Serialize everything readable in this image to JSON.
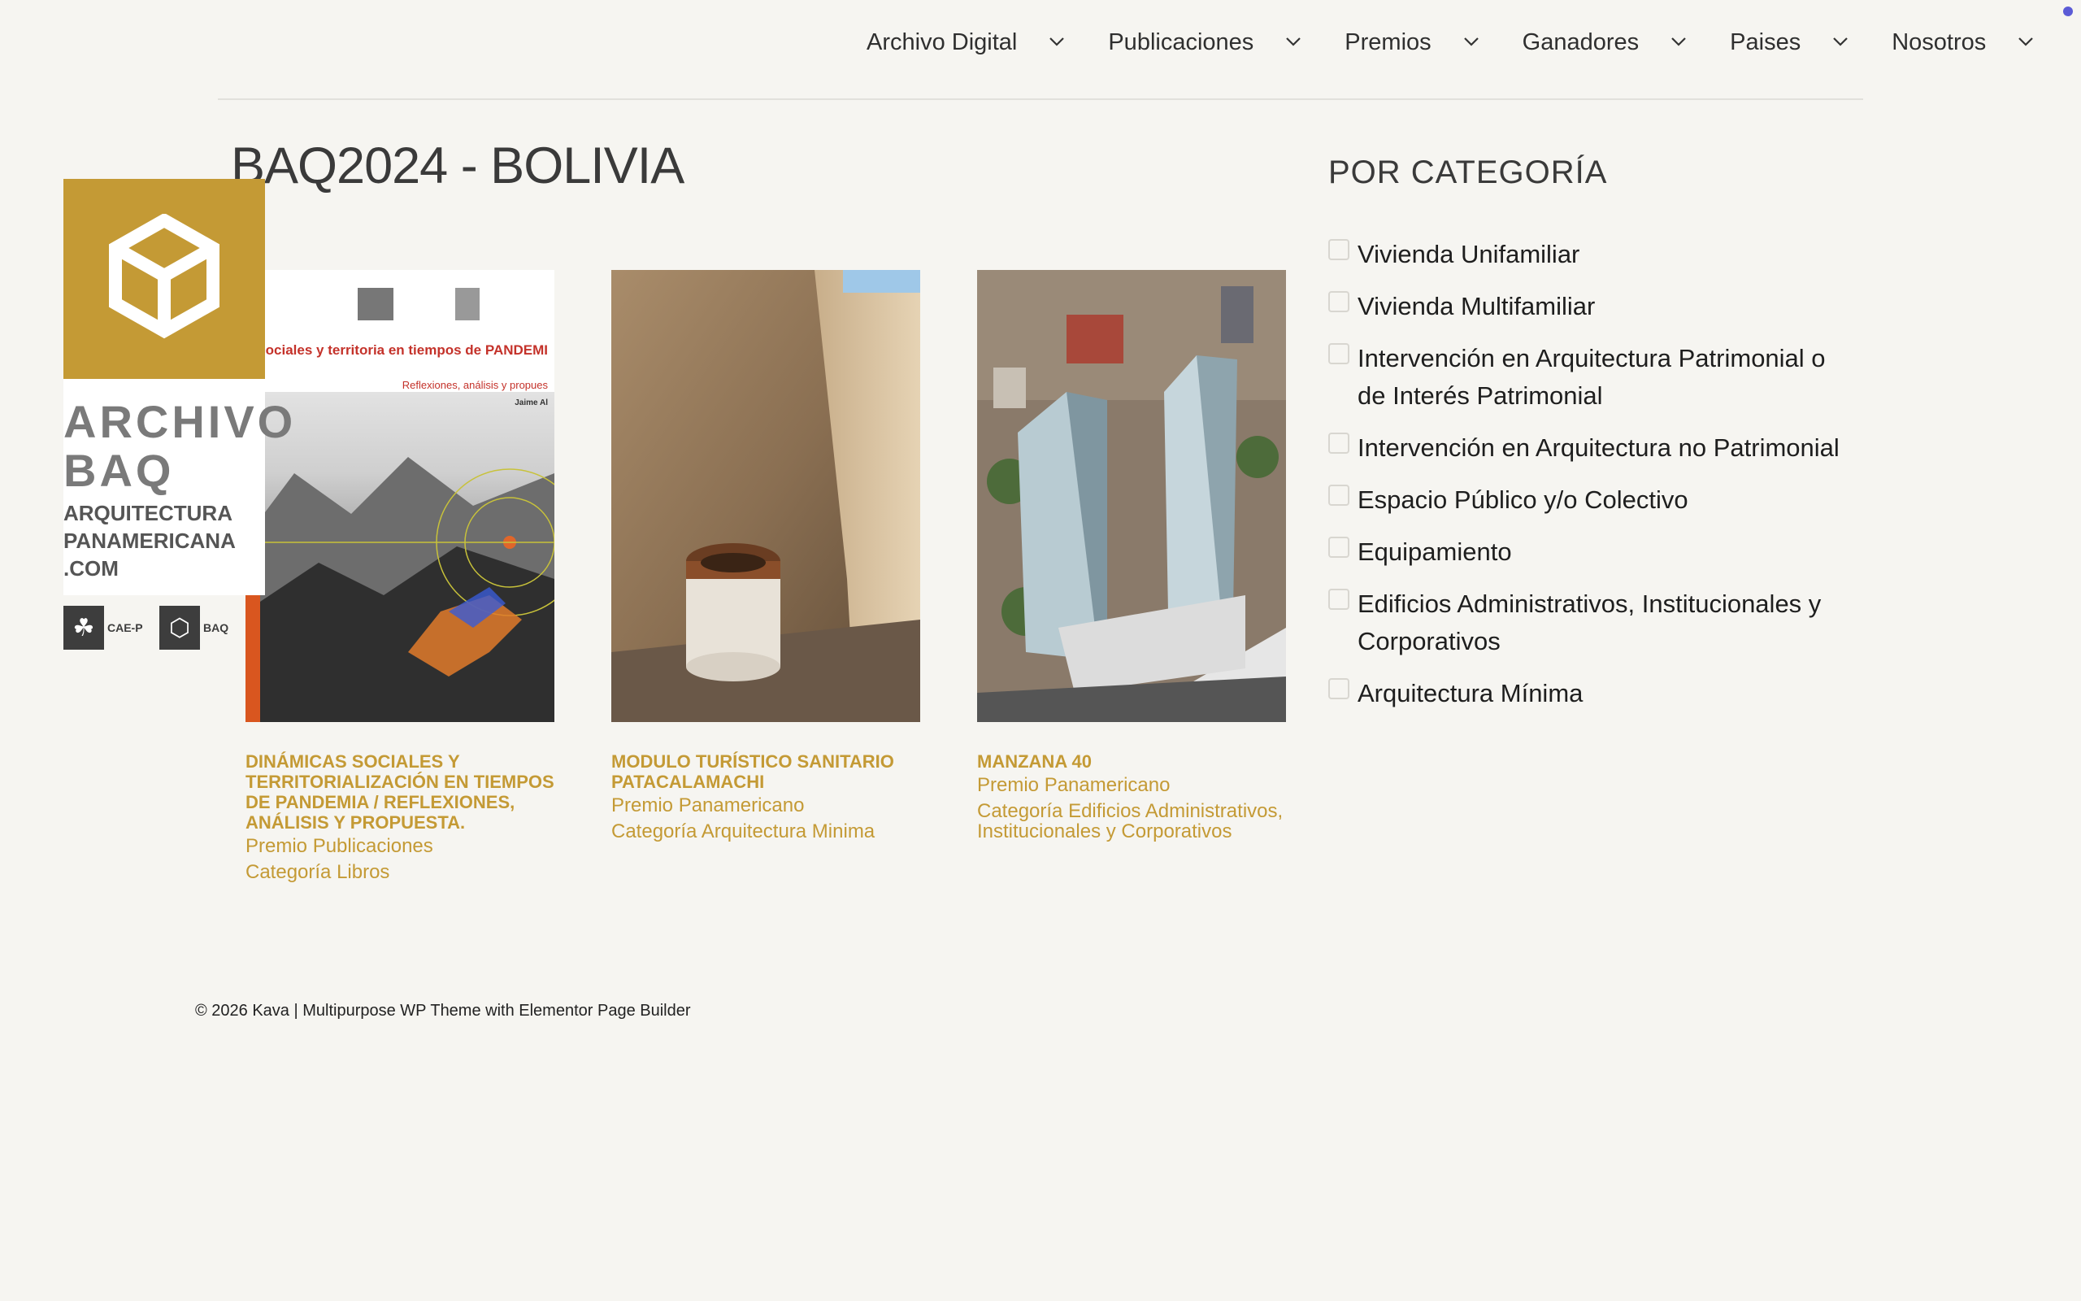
{
  "nav": {
    "items": [
      {
        "label": "Archivo Digital"
      },
      {
        "label": "Publicaciones"
      },
      {
        "label": "Premios"
      },
      {
        "label": "Ganadores"
      },
      {
        "label": "Paises"
      },
      {
        "label": "Nosotros"
      }
    ]
  },
  "page": {
    "title": "BAQ2024 - BOLIVIA"
  },
  "logo": {
    "word1": "ARCHIVO",
    "word2": "BAQ",
    "sub1": "ARQUITECTURA",
    "sub2": "PANAMERICANA",
    "sub3": ".COM",
    "partner1": "CAE-P",
    "partner2": "BAQ"
  },
  "cards": [
    {
      "title": "DINÁMICAS SOCIALES Y TERRITORIALIZACIÓN EN TIEMPOS DE PANDEMIA / REFLEXIONES, ANÁLISIS Y PROPUESTA.",
      "premio": "Premio Publicaciones",
      "categoria": "Categoría Libros",
      "cover_title": "Dinámicas sociales y territoria en tiempos de PANDEMI",
      "cover_sub": "Reflexiones, análisis y propues",
      "cover_author": "Jaime Al"
    },
    {
      "title": "MODULO TURÍSTICO SANITARIO PATACALAMACHI",
      "premio": "Premio Panamericano",
      "categoria": "Categoría Arquitectura Minima"
    },
    {
      "title": "MANZANA 40",
      "premio": "Premio Panamericano",
      "categoria": "Categoría Edificios Administrativos, Institucionales y Corporativos"
    }
  ],
  "sidebar": {
    "title": "POR CATEGORÍA",
    "categories": [
      {
        "label": "Vivienda Unifamiliar",
        "checked": false
      },
      {
        "label": "Vivienda Multifamiliar",
        "checked": false
      },
      {
        "label": "Intervención en Arquitectura Patrimonial o de Interés Patrimonial",
        "checked": false
      },
      {
        "label": "Intervención en Arquitectura no Patrimonial",
        "checked": false
      },
      {
        "label": "Espacio Público y/o Colectivo",
        "checked": false
      },
      {
        "label": "Equipamiento",
        "checked": false
      },
      {
        "label": "Edificios Administrativos, Institucionales y Corporativos",
        "checked": false
      },
      {
        "label": "Arquitectura Mínima",
        "checked": false
      }
    ]
  },
  "footer": {
    "text": "© 2026 Kava | Multipurpose WP Theme with Elementor Page Builder"
  },
  "colors": {
    "accent": "#c49a35",
    "background": "#f6f5f1",
    "text": "#2f2f2f"
  }
}
